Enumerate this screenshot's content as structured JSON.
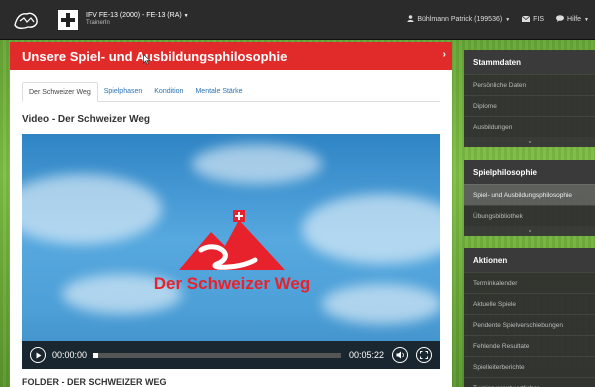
{
  "topbar": {
    "team_title": "IFV FE-13 (2000) - FE-13 (RA)",
    "team_role": "TrainerIn",
    "user": "Bühlmann Patrick (199536)",
    "fis_label": "FIS",
    "help_label": "Hilfe"
  },
  "main": {
    "header": "Unsere Spiel- und Ausbildungsphilosophie",
    "tabs": [
      {
        "label": "Der Schweizer Weg"
      },
      {
        "label": "Spielphasen"
      },
      {
        "label": "Kondition"
      },
      {
        "label": "Mentale Stärke"
      }
    ],
    "section_title": "Video - Der Schweizer Weg",
    "video": {
      "brand_text": "Der Schweizer Weg",
      "current_time": "00:00:00",
      "duration": "00:05:22",
      "progress": 0.02
    },
    "folder_title": "FOLDER - DER SCHWEIZER WEG"
  },
  "sidebar": {
    "stammdaten": {
      "title": "Stammdaten",
      "items": [
        {
          "label": "Persönliche Daten"
        },
        {
          "label": "Diplome"
        },
        {
          "label": "Ausbildungen"
        }
      ]
    },
    "spielphilosophie": {
      "title": "Spielphilosophie",
      "items": [
        {
          "label": "Spiel- und Ausbildungsphilosophie"
        },
        {
          "label": "Übungsbibliothek"
        }
      ]
    },
    "aktionen": {
      "title": "Aktionen",
      "items": [
        {
          "label": "Terminkalender"
        },
        {
          "label": "Aktuelle Spiele"
        },
        {
          "label": "Pendente Spielverschiebungen"
        },
        {
          "label": "Fehlende Resultate"
        },
        {
          "label": "Spielleiterberichte"
        },
        {
          "label": "Turnierverantwortlicher"
        }
      ]
    }
  },
  "colors": {
    "accent_red": "#e12b2b",
    "topbar": "#2b2b2b",
    "link_blue": "#2a72b5"
  }
}
